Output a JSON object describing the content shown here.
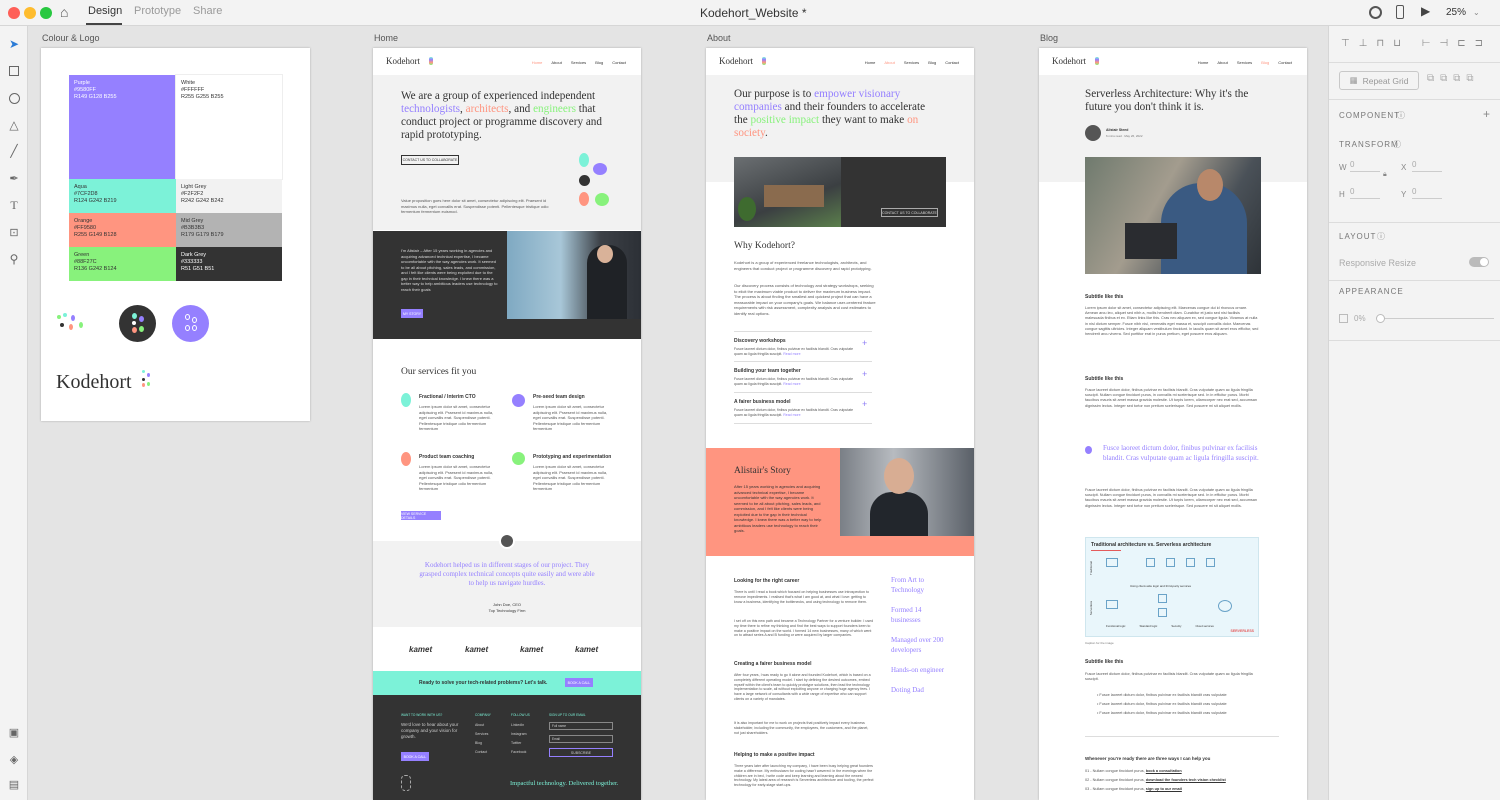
{
  "app": {
    "tabs": [
      "Design",
      "Prototype",
      "Share"
    ],
    "doc_title": "Kodehort_Website *",
    "zoom": "25%"
  },
  "panel": {
    "repeat_grid": "Repeat Grid",
    "component": "COMPONENT",
    "transform": "TRANSFORM",
    "w_label": "W",
    "w_val": "0",
    "x_label": "X",
    "x_val": "0",
    "h_label": "H",
    "h_val": "0",
    "y_label": "Y",
    "y_val": "0",
    "layout": "LAYOUT",
    "responsive": "Responsive Resize",
    "appearance": "APPEARANCE",
    "opacity": "0%"
  },
  "artboards": {
    "logo": "Colour & Logo",
    "home": "Home",
    "about": "About",
    "blog": "Blog"
  },
  "swatches": [
    {
      "name": "Purple",
      "hex": "#9580FF",
      "rgb": "R149 G128 B255",
      "bg": "#9580ff",
      "fg": "#fff"
    },
    {
      "name": "White",
      "hex": "#FFFFFF",
      "rgb": "R255 G255 B255",
      "bg": "#ffffff",
      "fg": "#333"
    },
    {
      "name": "Aqua",
      "hex": "#7CF2D8",
      "rgb": "R124 G242 B219",
      "bg": "#7cf2d8",
      "fg": "#333"
    },
    {
      "name": "Light Grey",
      "hex": "#F2F2F2",
      "rgb": "R242 G242 B242",
      "bg": "#f2f2f2",
      "fg": "#333"
    },
    {
      "name": "Orange",
      "hex": "#FF9580",
      "rgb": "R255 G149 B128",
      "bg": "#ff9580",
      "fg": "#333"
    },
    {
      "name": "Mid Grey",
      "hex": "#B3B3B3",
      "rgb": "R179 G179 B179",
      "bg": "#b3b3b3",
      "fg": "#333"
    },
    {
      "name": "Green",
      "hex": "#88F27C",
      "rgb": "R136 G242 B124",
      "bg": "#88f27c",
      "fg": "#333"
    },
    {
      "name": "Dark Grey",
      "hex": "#333333",
      "rgb": "R51 G51 B51",
      "bg": "#333333",
      "fg": "#fff"
    }
  ],
  "brand": "Kodehort",
  "nav": [
    "Home",
    "About",
    "Services",
    "Blog",
    "Contact"
  ],
  "home": {
    "h_a": "We are a group of experienced independent",
    "h_b": "technologists",
    "h_c": ", ",
    "h_d": "architects",
    "h_e": ", and ",
    "h_f": "engineers",
    "h_g": "that conduct project or programme discovery and rapid prototyping.",
    "cta": "CONTACT US TO COLLABORATE",
    "value": "Value proposition goes here dolor sit amet, consectetur adipiscing elit. Praesent id maximus nulla, eget convallis erat. Suspendisse potenti. Pellentesque tristique odio fermentum fermentum euismod.",
    "story": "I'm Alistair – After 15 years working in agencies and acquiring advanced technical expertise, I became uncomfortable with the way agencies work. It seemed to be all about pitching, sales leads, and commission, and I felt like clients were being exploited due to the gap in their technical knowledge. I knew there was a better way to help ambitious leaders use technology to reach their goals",
    "story_btn": "MY STORY",
    "services_title": "Our services fit you",
    "services": [
      "Fractional / Interim CTO",
      "Pre-seed team design",
      "Product team coaching",
      "Prototyping and experimentation"
    ],
    "svc_body": "Lorem ipsum dolor sit amet, consectetur adipiscing elit. Praesent id maximus nulla, eget convallis erat. Suspendisse potenti. Pellentesque tristique odio fermentum fermentum",
    "svc_btn": "VIEW SERVICE DETAILS",
    "quote": "Kodehort helped us in different stages of our project. They grasped complex technical concepts quite easily and were able to help us navigate hurdles.",
    "q_name": "John Doe, CEO",
    "q_org": "Top Technology Firm",
    "client": "kamet",
    "band": "Ready to solve your tech-related problems? Let's talk.",
    "band_btn": "BOOK A CALL",
    "f_h1": "WANT TO WORK WITH US?",
    "f_p": "We'd love to hear about your company and your vision for growth.",
    "f_btn": "BOOK A CALL",
    "f_h2": "COMPANY",
    "f_company": [
      "About",
      "Services",
      "Blog",
      "Contact"
    ],
    "f_h3": "FOLLOW US",
    "f_follow": [
      "LinkedIn",
      "Instagram",
      "Twitter",
      "Facebook"
    ],
    "f_h4": "SIGN UP TO OUR EMAIL",
    "f_name": "Full name",
    "f_email": "Email",
    "f_sub": "SUBSCRIBE",
    "f_tag": "Impactful technology. Delivered together."
  },
  "about": {
    "h_a": "Our purpose is to ",
    "h_b": "empower visionary companies",
    "h_c": " and their founders to accelerate the ",
    "h_d": "positive impact",
    "h_e": " they want to make ",
    "h_f": "on society",
    "cta": "CONTACT US TO COLLABORATE",
    "why": "Why Kodehort?",
    "why_p1": "Kodehort is a group of experienced freelance technologists, architects, and engineers that conduct project or programme discovery and rapid prototyping.",
    "why_p2": "Our discovery process consists of technology and strategy workshops, seeking to elicit the maximum viable product to deliver the maximum business impact. The process is about finding the smallest and quickest project that can have a measurable impact on your company's goals. We balance user-centered feature requirements with risk assessment, complexity analysis and cost estimates to identify real options.",
    "acc": [
      "Discovery workshops",
      "Building your team together",
      "A fairer business model"
    ],
    "acc_body": "Fusce laoreet dictum dolor, finibus pulvinar ex facilisis blandit. Cras vulputate quam ac ligula fringilla suscipit.",
    "read": "Read more",
    "story_t": "Alistair's Story",
    "story_p": "After 15 years working in agencies and acquiring advanced technical expertise, I became uncomfortable with the way agencies work. It seemed to be all about pitching, sales leads, and commission, and I felt like clients were being exploited due to the gap in their technical knowledge. I knew there was a better way to help ambitious leaders use technology to reach their goals.",
    "s1": "Looking for the right career",
    "s1_p": "There is until I read a book which focused on helping businesses use introspection to remove impediments. I realised that's what I am good at, and what I love: getting to know a business, identifying the bottlenecks, and using technology to remove them.",
    "s1_p2": "I set off on this new path and became a Technology Partner for a venture builder. I used my time there to refine my thinking and find the best ways to support founders keen to make a positive impact on the world. I formed 14 new businesses, many of which went on to attract series A and B funding or were acquired by larger companies.",
    "s2": "Creating a fairer business model",
    "s2_p": "After four years, I was ready to go it alone and founded Kodehort, which is based on a completely different operating model. I start by defining the desired outcomes, embed myself within the client's team to quickly prototype solutions, then lead the technology implementation to scale, all without exploiting anyone or charging huge agency fees. I have a large network of consultants with a wide range of expertise who can support clients on a variety of mandates.",
    "s2_p2": "It is also important for me to work on projects that positively impact every business stakeholder, including the community, the employees, the customers, and the planet, not just shareholders.",
    "s3": "Helping to make a positive impact",
    "s3_p": "Three years later after launching my company, I have been busy helping great founders make a difference. My enthusiasm for coding hasn't wavered: in the evenings when the children are in bed, I write code and keep learning and learning about the newest technology. My latest area of research is Serverless architecture and tooling, the perfect technology for early-stage start-ups.",
    "facts": [
      "From Art to Technology",
      "Formed 14 businesses",
      "Managed over 200 developers",
      "Hands-on engineer",
      "Doting Dad"
    ]
  },
  "blog": {
    "title": "Serverless Architecture: Why it's the future you don't think it is.",
    "author": "Alistair Steed",
    "meta": "6 mins read · May 26, 2022",
    "sub": "Subtitle like this",
    "p1": "Lorem ipsum dolor sit amet, consectetur adipiscing elit. Maecenas congue dui id rhoncus ornare. Aenean arcu leo, aliquet sed nibh a, mollis hendrerit diam. Curabitur et justo sed nisi facilisis malesuada finibus et ex. Etiam links like this. Cras nec aliquam ex, sed congue ligula. Vivamus at nulla in nisl dictum semper. Fusce nibh nisl, venenatis eget massa et, suscipit convallis dolor. Maecenas congue sagittis ultricies. Integer aliquam vestibulum tincidunt. In iaculis quam sit amet eros efficitur, sed hendrerit arcu viverra. Sed porttitor erat in purus pretium, eget posuere eros aliquam.",
    "p2": "Fusce laoreet dictum dolor, finibus pulvinar ex facilisis blandit. Cras vulputate quam ac ligula fringilla suscipit. Nullam congue tincidunt purus, in convallis mi scelerisque sed. In in efficitur purus. Morbi faucibus mauris sit amet massa gravida molestie. Ut turpis lorem, ullamcorper nec erat sed, accumsan dignissim lectus. Integer sed tortor non pretium scelerisque. Sed posuere mi sit aliquet mollis.",
    "pull": "Fusce laoreet dictum dolor, finibus pulvinar ex facilisis blandit. Cras vulputate quam ac ligula fringilla suscipit.",
    "diag_title": "Traditional architecture vs. Serverless architecture",
    "diag_a": "Traditional",
    "diag_b": "Serverless",
    "diag_mid": "Using client-side logic and third-party services",
    "diag_legend": [
      "Functional logic",
      "Standard logic",
      "Security",
      "Cloud services"
    ],
    "diag_brand": "SERVERLESS",
    "caption": "Caption for the image",
    "bullet": "Fusce laoreet dictum dolor, finibus pulvinar ex facilisis blandit cras vulputate",
    "ways": "Whenever you're ready there are three ways I can help you",
    "w1a": "01 - Nullam congue tincidunt purus, ",
    "w1b": "book a consultation",
    "w2a": "02 - Nullam congue tincidunt purus, ",
    "w2b": "download the founders tech vision checklist",
    "w3a": "03 - Nullam congue tincidunt purus, ",
    "w3b": "sign up to our email"
  }
}
